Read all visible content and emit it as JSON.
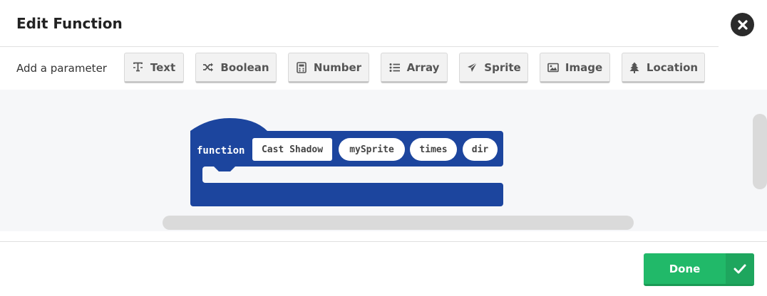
{
  "dialog": {
    "title": "Edit Function"
  },
  "parameters": {
    "label": "Add a parameter",
    "buttons": [
      {
        "label": "Text",
        "icon": "text-icon"
      },
      {
        "label": "Boolean",
        "icon": "shuffle-icon"
      },
      {
        "label": "Number",
        "icon": "calculator-icon"
      },
      {
        "label": "Array",
        "icon": "list-icon"
      },
      {
        "label": "Sprite",
        "icon": "paper-plane-icon"
      },
      {
        "label": "Image",
        "icon": "image-icon"
      },
      {
        "label": "Location",
        "icon": "tree-icon"
      }
    ]
  },
  "block": {
    "keyword": "function",
    "name": "Cast Shadow",
    "params": [
      "mySprite",
      "times",
      "dir"
    ],
    "color": "#1c459e"
  },
  "footer": {
    "done_label": "Done",
    "done_color": "#21b969"
  }
}
